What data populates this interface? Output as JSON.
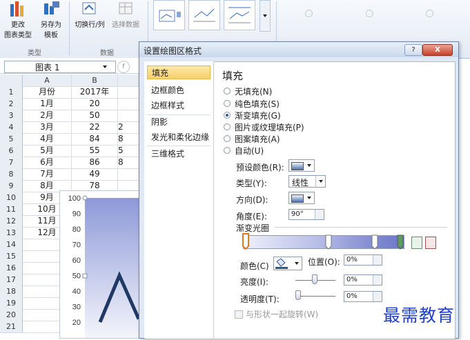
{
  "ribbon": {
    "change_type_label_1": "更改",
    "change_type_label_2": "图表类型",
    "save_as_label_1": "另存为",
    "save_as_label_2": "模板",
    "switch_row_col_label": "切换行/列",
    "select_data_label": "选择数据",
    "group_type": "类型",
    "group_data": "数据"
  },
  "namebox": {
    "value": "图表 1",
    "fx": "f"
  },
  "sheet": {
    "col_headers": [
      "A",
      "B"
    ],
    "rows": [
      {
        "num": "1",
        "a": "月份",
        "b": "2017年",
        "c": ""
      },
      {
        "num": "2",
        "a": "1月",
        "b": "20",
        "c": ""
      },
      {
        "num": "3",
        "a": "2月",
        "b": "50",
        "c": ""
      },
      {
        "num": "4",
        "a": "3月",
        "b": "22",
        "c": "2"
      },
      {
        "num": "5",
        "a": "4月",
        "b": "84",
        "c": "8"
      },
      {
        "num": "6",
        "a": "5月",
        "b": "55",
        "c": "5"
      },
      {
        "num": "7",
        "a": "6月",
        "b": "86",
        "c": "8"
      },
      {
        "num": "8",
        "a": "7月",
        "b": "49",
        "c": ""
      },
      {
        "num": "9",
        "a": "8月",
        "b": "78",
        "c": ""
      },
      {
        "num": "10",
        "a": "9月",
        "b": "",
        "c": ""
      },
      {
        "num": "11",
        "a": "10月",
        "b": "",
        "c": ""
      },
      {
        "num": "12",
        "a": "11月",
        "b": "",
        "c": ""
      },
      {
        "num": "13",
        "a": "12月",
        "b": "",
        "c": ""
      },
      {
        "num": "14",
        "a": "",
        "b": "",
        "c": ""
      },
      {
        "num": "15",
        "a": "",
        "b": "",
        "c": ""
      },
      {
        "num": "16",
        "a": "",
        "b": "",
        "c": ""
      },
      {
        "num": "17",
        "a": "",
        "b": "",
        "c": ""
      },
      {
        "num": "18",
        "a": "",
        "b": "",
        "c": ""
      },
      {
        "num": "19",
        "a": "",
        "b": "",
        "c": ""
      },
      {
        "num": "20",
        "a": "",
        "b": "",
        "c": ""
      },
      {
        "num": "21",
        "a": "",
        "b": "",
        "c": ""
      }
    ]
  },
  "chart_data": {
    "type": "line",
    "title": "",
    "ylim": [
      0,
      100
    ],
    "yticks": [
      "100",
      "90",
      "80",
      "70",
      "60",
      "50",
      "40",
      "30",
      "20"
    ],
    "series": [
      {
        "values": [
          20,
          50,
          22
        ]
      }
    ],
    "plot_fill": "gradient",
    "grid": false
  },
  "dialog": {
    "title": "设置绘图区格式",
    "help_label": "?",
    "close_label": "X",
    "nav": [
      "填充",
      "边框颜色",
      "边框样式",
      "阴影",
      "发光和柔化边缘",
      "三维格式"
    ],
    "section_title": "填充",
    "options": [
      "无填充(N)",
      "纯色填充(S)",
      "渐变填充(G)",
      "图片或纹理填充(P)",
      "图案填充(A)",
      "自动(U)"
    ],
    "selected_option": "渐变填充(G)",
    "preset_label": "预设颜色(R):",
    "type_label": "类型(Y):",
    "type_value": "线性",
    "direction_label": "方向(D):",
    "angle_label": "角度(E):",
    "angle_value": "90°",
    "stops_label": "渐变光圈",
    "color_label": "颜色(C)",
    "position_label": "位置(O):",
    "position_value": "0%",
    "brightness_label": "亮度(I):",
    "brightness_value": "0%",
    "transparency_label": "透明度(T):",
    "transparency_value": "0%",
    "rotate_label": "与形状一起旋转(W)"
  },
  "watermark": "最需教育",
  "colors": {
    "accent": "#2b5797",
    "line": "#1f3864",
    "nav_active": "#f7d06a"
  }
}
